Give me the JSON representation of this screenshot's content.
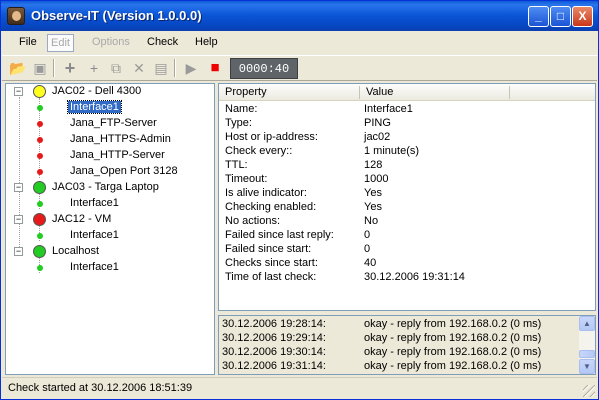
{
  "window": {
    "title": "Observe-IT (Version 1.0.0.0)",
    "minimize_label": "_",
    "maximize_label": "□",
    "close_label": "X"
  },
  "menu": {
    "file": "File",
    "edit": "Edit",
    "options": "Options",
    "check": "Check",
    "help": "Help"
  },
  "toolbar": {
    "timer": "0000:40",
    "icons": [
      "open-folder-icon",
      "save-icon",
      "add-host-icon",
      "add-interface-icon",
      "copy-icon",
      "delete-icon",
      "window-icon",
      "play-icon",
      "stop-icon"
    ]
  },
  "tree": {
    "hosts": [
      {
        "name": "JAC02 - Dell 4300",
        "status": "yellow",
        "interfaces": [
          {
            "name": "Interface1",
            "status": "green",
            "selected": true
          },
          {
            "name": "Jana_FTP-Server",
            "status": "red"
          },
          {
            "name": "Jana_HTTPS-Admin",
            "status": "red"
          },
          {
            "name": "Jana_HTTP-Server",
            "status": "red"
          },
          {
            "name": "Jana_Open Port 3128",
            "status": "red"
          }
        ]
      },
      {
        "name": "JAC03 - Targa Laptop",
        "status": "green",
        "interfaces": [
          {
            "name": "Interface1",
            "status": "green"
          }
        ]
      },
      {
        "name": "JAC12 - VM",
        "status": "red",
        "interfaces": [
          {
            "name": "Interface1",
            "status": "green"
          }
        ]
      },
      {
        "name": "Localhost",
        "status": "green",
        "interfaces": [
          {
            "name": "Interface1",
            "status": "green"
          }
        ]
      }
    ]
  },
  "properties": {
    "header_property": "Property",
    "header_value": "Value",
    "rows": [
      {
        "k": "Name:",
        "v": "Interface1"
      },
      {
        "k": "Type:",
        "v": "PING"
      },
      {
        "k": "Host or ip-address:",
        "v": "jac02"
      },
      {
        "k": "Check every::",
        "v": "1 minute(s)"
      },
      {
        "k": "TTL:",
        "v": "128"
      },
      {
        "k": "Timeout:",
        "v": "1000"
      },
      {
        "k": "Is alive indicator:",
        "v": "Yes"
      },
      {
        "k": "Checking enabled:",
        "v": "Yes"
      },
      {
        "k": "No actions:",
        "v": "No"
      },
      {
        "k": "Failed since last reply:",
        "v": "0"
      },
      {
        "k": "Failed since start:",
        "v": "0"
      },
      {
        "k": "Checks since start:",
        "v": "40"
      },
      {
        "k": "Time of last check:",
        "v": "30.12.2006 19:31:14"
      }
    ]
  },
  "log": {
    "rows": [
      {
        "t": "30.12.2006 19:28:14:",
        "m": "okay - reply from 192.168.0.2 (0 ms)"
      },
      {
        "t": "30.12.2006 19:29:14:",
        "m": "okay - reply from 192.168.0.2 (0 ms)"
      },
      {
        "t": "30.12.2006 19:30:14:",
        "m": "okay - reply from 192.168.0.2 (0 ms)"
      },
      {
        "t": "30.12.2006 19:31:14:",
        "m": "okay - reply from 192.168.0.2 (0 ms)"
      }
    ]
  },
  "status": {
    "text": "Check started at 30.12.2006 18:51:39"
  },
  "colors": {
    "green": "#22cc22",
    "yellow": "#ffff1f",
    "red": "#e61a1a",
    "selection": "#316ac5"
  }
}
